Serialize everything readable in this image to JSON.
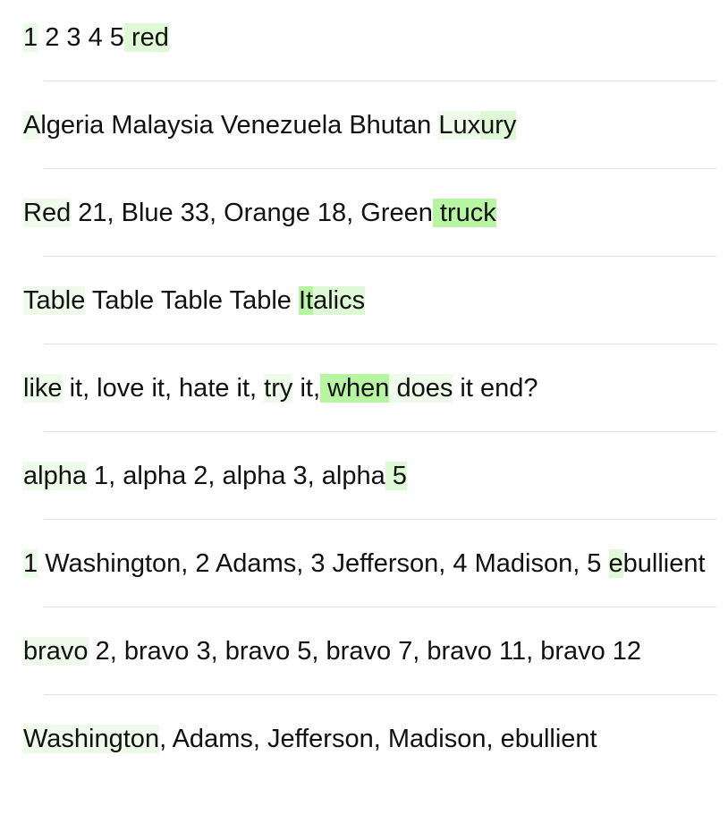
{
  "rows": [
    {
      "segments": [
        {
          "text": "1",
          "hl": "light"
        },
        {
          "text": " 2 3 4 5",
          "hl": ""
        },
        {
          "text": " red",
          "hl": "mid"
        }
      ]
    },
    {
      "segments": [
        {
          "text": "A",
          "hl": "light"
        },
        {
          "text": "lgeria Malaysia Venezuela Bhutan ",
          "hl": ""
        },
        {
          "text": "Lux",
          "hl": "light"
        },
        {
          "text": "ury",
          "hl": "mid"
        }
      ]
    },
    {
      "segments": [
        {
          "text": "Red",
          "hl": "light"
        },
        {
          "text": " 21, Blue 33, Orange 18, Green",
          "hl": ""
        },
        {
          "text": " truck",
          "hl": "strong"
        }
      ]
    },
    {
      "segments": [
        {
          "text": "Table",
          "hl": "light"
        },
        {
          "text": " Table Table Table ",
          "hl": ""
        },
        {
          "text": "It",
          "hl": "strong"
        },
        {
          "text": "alics",
          "hl": "mid"
        }
      ]
    },
    {
      "segments": [
        {
          "text": "like",
          "hl": "light"
        },
        {
          "text": " it, love it, hate it, ",
          "hl": ""
        },
        {
          "text": "try",
          "hl": "light"
        },
        {
          "text": " it,",
          "hl": ""
        },
        {
          "text": " when",
          "hl": "strong"
        },
        {
          "text": " does",
          "hl": "light"
        },
        {
          "text": " it end?",
          "hl": ""
        }
      ]
    },
    {
      "segments": [
        {
          "text": "alpha",
          "hl": "light"
        },
        {
          "text": " 1, alpha 2, alpha 3, alpha",
          "hl": ""
        },
        {
          "text": " 5",
          "hl": "mid"
        }
      ]
    },
    {
      "segments": [
        {
          "text": "1",
          "hl": "light"
        },
        {
          "text": " Washington, 2 Adams, 3 Jefferson, 4 Madison, 5 ",
          "hl": ""
        },
        {
          "text": "e",
          "hl": "mid"
        },
        {
          "text": "bullient",
          "hl": ""
        }
      ]
    },
    {
      "segments": [
        {
          "text": "bravo",
          "hl": "light"
        },
        {
          "text": " 2, bravo 3, bravo 5, bravo 7, bravo 11, bravo 12",
          "hl": ""
        }
      ]
    },
    {
      "segments": [
        {
          "text": "Washington",
          "hl": "light"
        },
        {
          "text": ", Adams, Jefferson, Madison, ebullient",
          "hl": ""
        }
      ]
    }
  ]
}
